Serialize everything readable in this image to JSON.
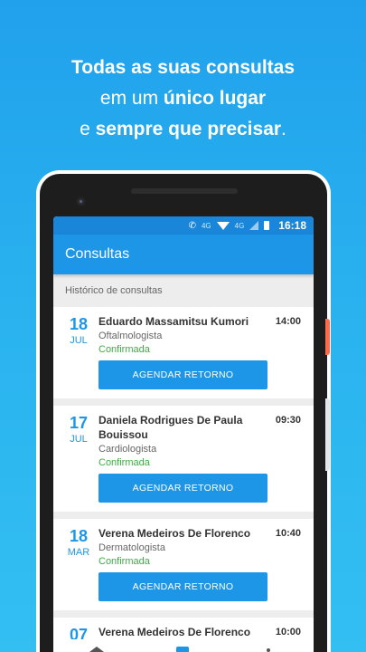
{
  "headline": {
    "line1": "Todas as suas consultas",
    "line2_a": "em um ",
    "line2_b": "único lugar",
    "line3_a": "e ",
    "line3_b": "sempre que precisar",
    "line3_c": "."
  },
  "statusbar": {
    "network_label": "4G",
    "network_label2": "4G",
    "time": "16:18"
  },
  "appbar": {
    "title": "Consultas"
  },
  "section": {
    "title": "Histórico de consultas"
  },
  "appointments": [
    {
      "day": "18",
      "month": "JUL",
      "doctor": "Eduardo Massamitsu Kumori",
      "specialty": "Oftalmologista",
      "status": "Confirmada",
      "time": "14:00",
      "action": "AGENDAR RETORNO"
    },
    {
      "day": "17",
      "month": "JUL",
      "doctor": "Daniela Rodrigues De Paula Bouissou",
      "specialty": "Cardiologista",
      "status": "Confirmada",
      "time": "09:30",
      "action": "AGENDAR RETORNO"
    },
    {
      "day": "18",
      "month": "MAR",
      "doctor": "Verena Medeiros De Florenco",
      "specialty": "Dermatologista",
      "status": "Confirmada",
      "time": "10:40",
      "action": "AGENDAR RETORNO"
    },
    {
      "day": "07",
      "month": "",
      "doctor": "Verena Medeiros De Florenco",
      "specialty": "",
      "status": "",
      "time": "10:00",
      "action": ""
    }
  ],
  "colors": {
    "primary": "#1e96e8",
    "status_confirmed": "#3cb043",
    "background_top": "#21a1ec"
  }
}
